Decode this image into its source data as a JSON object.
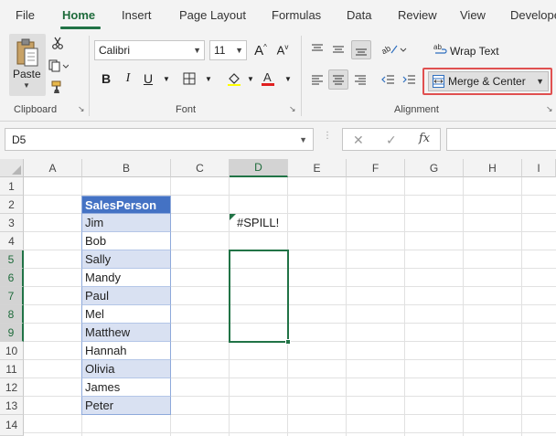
{
  "menu": {
    "tabs": [
      {
        "label": "File"
      },
      {
        "label": "Home",
        "active": true
      },
      {
        "label": "Insert"
      },
      {
        "label": "Page Layout"
      },
      {
        "label": "Formulas"
      },
      {
        "label": "Data"
      },
      {
        "label": "Review"
      },
      {
        "label": "View"
      },
      {
        "label": "Develope"
      }
    ]
  },
  "ribbon": {
    "clipboard": {
      "paste_label": "Paste",
      "group_label": "Clipboard"
    },
    "font": {
      "font_name": "Calibri",
      "font_size": "11",
      "group_label": "Font",
      "font_color": "#e02020"
    },
    "alignment": {
      "wrap_text_label": "Wrap Text",
      "merge_center_label": "Merge & Center",
      "group_label": "Alignment"
    }
  },
  "formula_bar": {
    "name_box": "D5",
    "formula": ""
  },
  "grid": {
    "columns": [
      "A",
      "B",
      "C",
      "D",
      "E",
      "F",
      "G",
      "H",
      "I"
    ],
    "rows": [
      "1",
      "2",
      "3",
      "4",
      "5",
      "6",
      "7",
      "8",
      "9",
      "10",
      "11",
      "12",
      "13",
      "14"
    ],
    "selected_column": "D",
    "selected_rows": [
      "5",
      "6",
      "7",
      "8",
      "9"
    ],
    "cells": {
      "B2": "SalesPerson",
      "B3": "Jim",
      "B4": "Bob",
      "B5": "Sally",
      "B6": "Mandy",
      "B7": "Paul",
      "B8": "Mel",
      "B9": "Matthew",
      "B10": "Hannah",
      "B11": "Olivia",
      "B12": "James",
      "B13": "Peter",
      "D3": "#SPILL!"
    },
    "colors": {
      "table_header": "#4472c4",
      "table_band": "#d9e1f2",
      "selection": "#217346",
      "highlight": "#e05050"
    }
  }
}
